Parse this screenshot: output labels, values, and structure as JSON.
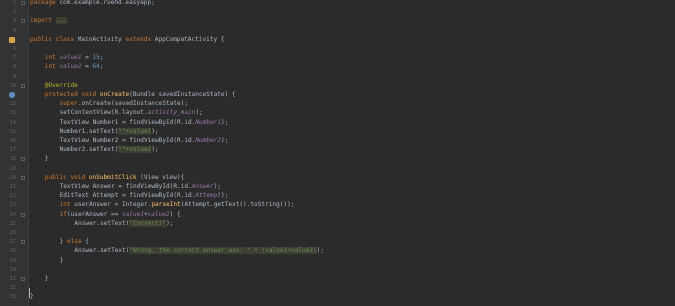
{
  "editor": {
    "lines": [
      {
        "n": "1",
        "indent": 0,
        "fold": true,
        "tokens": [
          [
            "kw",
            "package "
          ],
          [
            "",
            "com.example.ruehd.easyapp;"
          ]
        ]
      },
      {
        "n": "2",
        "indent": 0,
        "tokens": []
      },
      {
        "n": "3",
        "indent": 0,
        "fold": true,
        "tokens": [
          [
            "kw",
            "import "
          ],
          [
            "hl",
            "..."
          ]
        ]
      },
      {
        "n": "4",
        "indent": 0,
        "tokens": []
      },
      {
        "n": "5",
        "indent": 0,
        "marker": "run-class-icon",
        "tokens": [
          [
            "kw",
            "public class "
          ],
          [
            "",
            "MainActivity "
          ],
          [
            "kw",
            "extends "
          ],
          [
            "",
            "AppCompatActivity {"
          ]
        ]
      },
      {
        "n": "6",
        "indent": 0,
        "tokens": []
      },
      {
        "n": "7",
        "indent": 2,
        "tokens": [
          [
            "kw",
            "int "
          ],
          [
            "fld",
            "value1"
          ],
          [
            "",
            " = "
          ],
          [
            "num",
            "15"
          ],
          [
            "",
            ";"
          ]
        ]
      },
      {
        "n": "8",
        "indent": 2,
        "tokens": [
          [
            "kw",
            "int "
          ],
          [
            "fld",
            "value2"
          ],
          [
            "",
            " = "
          ],
          [
            "num",
            "64"
          ],
          [
            "",
            ";"
          ]
        ]
      },
      {
        "n": "9",
        "indent": 0,
        "tokens": []
      },
      {
        "n": "10",
        "indent": 2,
        "fold": true,
        "tokens": [
          [
            "an",
            "@Override"
          ]
        ]
      },
      {
        "n": "11",
        "indent": 2,
        "marker": "override-icon",
        "tokens": [
          [
            "kw",
            "protected void "
          ],
          [
            "fn",
            "onCreate"
          ],
          [
            "",
            "(Bundle savedInstanceState) {"
          ]
        ]
      },
      {
        "n": "12",
        "indent": 4,
        "tokens": [
          [
            "kw",
            "super"
          ],
          [
            "",
            ".onCreate(savedInstanceState);"
          ]
        ]
      },
      {
        "n": "13",
        "indent": 4,
        "tokens": [
          [
            "",
            "setContentView(R.layout."
          ],
          [
            "fld",
            "activity_main"
          ],
          [
            "",
            ");"
          ]
        ]
      },
      {
        "n": "14",
        "indent": 4,
        "tokens": [
          [
            "",
            "TextView Number1 = findViewById(R.id."
          ],
          [
            "fld",
            "Number1"
          ],
          [
            "",
            ");"
          ]
        ]
      },
      {
        "n": "15",
        "indent": 4,
        "tokens": [
          [
            "",
            "Number1.setText("
          ],
          [
            "hl",
            "\"\"+value1"
          ],
          [
            "",
            ");"
          ]
        ]
      },
      {
        "n": "16",
        "indent": 4,
        "tokens": [
          [
            "",
            "TextView Number2 = findViewById(R.id."
          ],
          [
            "fld",
            "Number2"
          ],
          [
            "",
            ");"
          ]
        ]
      },
      {
        "n": "17",
        "indent": 4,
        "tokens": [
          [
            "",
            "Number2.setText("
          ],
          [
            "hl",
            "\"\"+value2"
          ],
          [
            "",
            ");"
          ]
        ]
      },
      {
        "n": "18",
        "indent": 2,
        "fold": true,
        "tokens": [
          [
            "",
            "}"
          ]
        ]
      },
      {
        "n": "19",
        "indent": 0,
        "tokens": []
      },
      {
        "n": "20",
        "indent": 2,
        "fold": true,
        "tokens": [
          [
            "kw",
            "public void "
          ],
          [
            "fn",
            "onSubmitClick"
          ],
          [
            "",
            " (View view){"
          ]
        ]
      },
      {
        "n": "21",
        "indent": 4,
        "tokens": [
          [
            "",
            "TextView Answer = findViewById(R.id."
          ],
          [
            "fld",
            "Answer"
          ],
          [
            "",
            ");"
          ]
        ]
      },
      {
        "n": "22",
        "indent": 4,
        "tokens": [
          [
            "",
            "EditText Attempt = findViewById(R.id."
          ],
          [
            "fld",
            "Attempt"
          ],
          [
            "",
            ");"
          ]
        ]
      },
      {
        "n": "23",
        "indent": 4,
        "tokens": [
          [
            "kw",
            "int "
          ],
          [
            "",
            "userAnswer = Integer."
          ],
          [
            "fn",
            "parseInt"
          ],
          [
            "",
            "(Attempt.getText().toString());"
          ]
        ]
      },
      {
        "n": "24",
        "indent": 4,
        "fold": true,
        "tokens": [
          [
            "kw",
            "if"
          ],
          [
            "",
            "(userAnswer == "
          ],
          [
            "fld",
            "value1"
          ],
          [
            "",
            "+"
          ],
          [
            "fld",
            "value2"
          ],
          [
            "",
            ") {"
          ]
        ]
      },
      {
        "n": "25",
        "indent": 6,
        "tokens": [
          [
            "",
            "Answer.setText("
          ],
          [
            "hl",
            "\"Correct!\""
          ],
          [
            "",
            ");"
          ]
        ]
      },
      {
        "n": "26",
        "indent": 0,
        "tokens": []
      },
      {
        "n": "27",
        "indent": 4,
        "fold": true,
        "tokens": [
          [
            "",
            "} "
          ],
          [
            "kw",
            "else "
          ],
          [
            "",
            "{"
          ]
        ]
      },
      {
        "n": "28",
        "indent": 6,
        "tokens": [
          [
            "",
            "Answer.setText("
          ],
          [
            "hl",
            "\"Wrong, the correct answer was: \" + (value1+value2)"
          ],
          [
            "",
            ");"
          ]
        ]
      },
      {
        "n": "29",
        "indent": 4,
        "tokens": [
          [
            "",
            "}"
          ]
        ]
      },
      {
        "n": "30",
        "indent": 0,
        "tokens": []
      },
      {
        "n": "31",
        "indent": 2,
        "fold": true,
        "tokens": [
          [
            "",
            "}"
          ]
        ]
      },
      {
        "n": "32",
        "indent": 0,
        "tokens": []
      },
      {
        "n": "33",
        "indent": 0,
        "tokens": [
          [
            "",
            "}"
          ]
        ]
      }
    ]
  }
}
